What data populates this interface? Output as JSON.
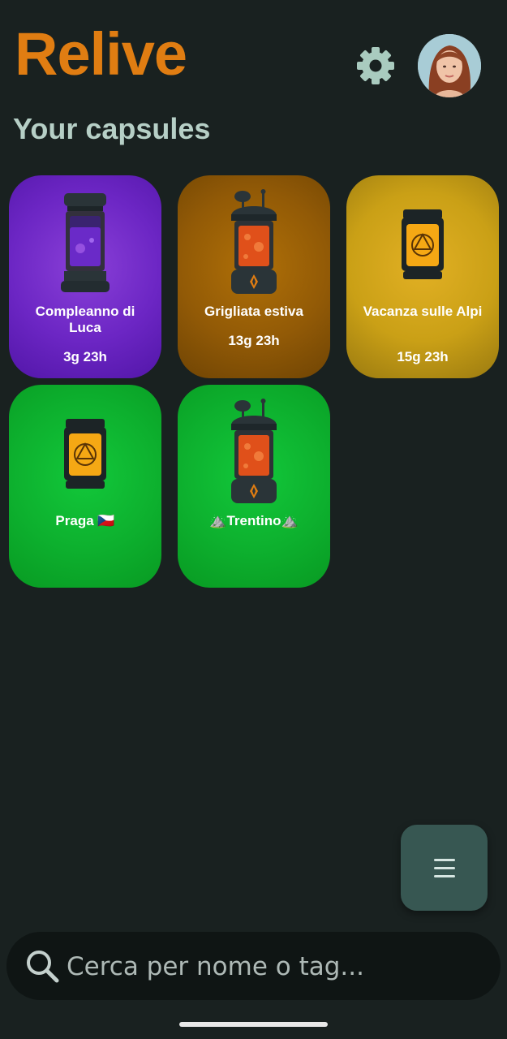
{
  "header": {
    "app_title": "Relive",
    "section_title": "Your capsules"
  },
  "colors": {
    "brand_orange": "#e07d12",
    "background": "#192120",
    "card_purple": "#6c26c4",
    "card_brown": "#925a06",
    "card_gold": "#caa016",
    "card_green": "#0db02e",
    "fab": "#375752"
  },
  "icons": {
    "settings": "gear-icon",
    "menu": "hamburger-icon",
    "search": "search-icon"
  },
  "capsules": [
    {
      "name": "Compleanno di Luca",
      "time": "3g 23h",
      "color": "purple",
      "jar": "purple-capsule"
    },
    {
      "name": "Grigliata estiva",
      "time": "13g 23h",
      "color": "brown",
      "jar": "orange-bubbling-capsule"
    },
    {
      "name": "Vacanza sulle Alpi",
      "time": "15g 23h",
      "color": "gold",
      "jar": "golden-rune-capsule"
    },
    {
      "name": "Praga 🇨🇿",
      "time": "",
      "color": "green",
      "jar": "golden-rune-capsule"
    },
    {
      "name": "⛰️Trentino⛰️",
      "time": "",
      "color": "green",
      "jar": "orange-bubbling-capsule"
    }
  ],
  "search": {
    "placeholder": "Cerca per nome o tag..."
  }
}
